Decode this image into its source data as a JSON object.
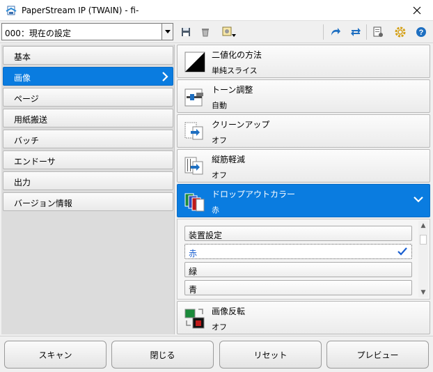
{
  "window": {
    "title": "PaperStream IP (TWAIN) - fi-"
  },
  "toolbar": {
    "profile_value": "000：現在の設定"
  },
  "nav": {
    "items": [
      {
        "label": "基本",
        "active": false
      },
      {
        "label": "画像",
        "active": true
      },
      {
        "label": "ページ",
        "active": false
      },
      {
        "label": "用紙搬送",
        "active": false
      },
      {
        "label": "バッチ",
        "active": false
      },
      {
        "label": "エンドーサ",
        "active": false
      },
      {
        "label": "出力",
        "active": false
      },
      {
        "label": "バージョン情報",
        "active": false
      }
    ]
  },
  "settings": {
    "binarization": {
      "title": "二値化の方法",
      "value": "単純スライス"
    },
    "tone": {
      "title": "トーン調整",
      "value": "自動"
    },
    "cleanup": {
      "title": "クリーンアップ",
      "value": "オフ"
    },
    "streak": {
      "title": "縦筋軽減",
      "value": "オフ"
    },
    "dropout": {
      "title": "ドロップアウトカラー",
      "value": "赤"
    },
    "dropout_options": [
      "装置設定",
      "赤",
      "緑",
      "青"
    ],
    "dropout_selected": "赤",
    "invert": {
      "title": "画像反転",
      "value": "オフ"
    }
  },
  "buttons": {
    "scan": "スキャン",
    "close": "閉じる",
    "reset": "リセット",
    "preview": "プレビュー"
  },
  "colors": {
    "accent": "#0a7ce0"
  }
}
